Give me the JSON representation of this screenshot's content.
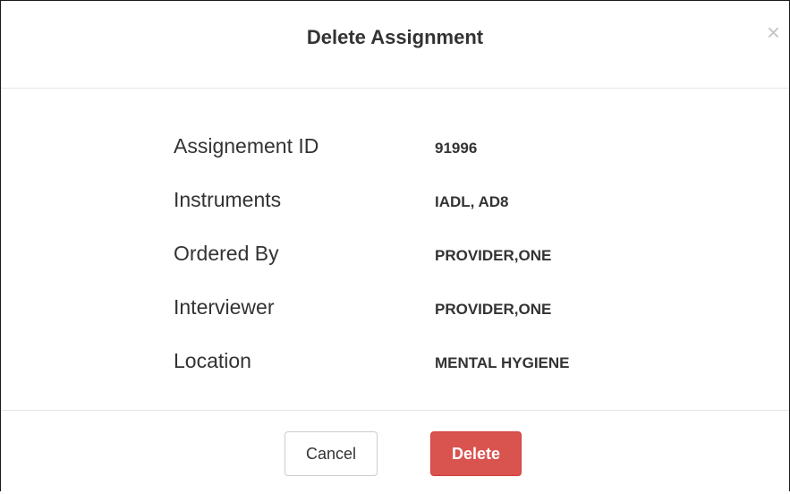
{
  "dialog": {
    "title": "Delete Assignment",
    "close_symbol": "×"
  },
  "details": [
    {
      "label": "Assignement ID",
      "value": "91996"
    },
    {
      "label": "Instruments",
      "value": "IADL, AD8"
    },
    {
      "label": "Ordered By",
      "value": "PROVIDER,ONE"
    },
    {
      "label": "Interviewer",
      "value": "PROVIDER,ONE"
    },
    {
      "label": "Location",
      "value": "MENTAL HYGIENE"
    }
  ],
  "footer": {
    "cancel_label": "Cancel",
    "delete_label": "Delete"
  },
  "colors": {
    "danger": "#d9534f",
    "text": "#333333",
    "divider": "#e5e5e5"
  }
}
